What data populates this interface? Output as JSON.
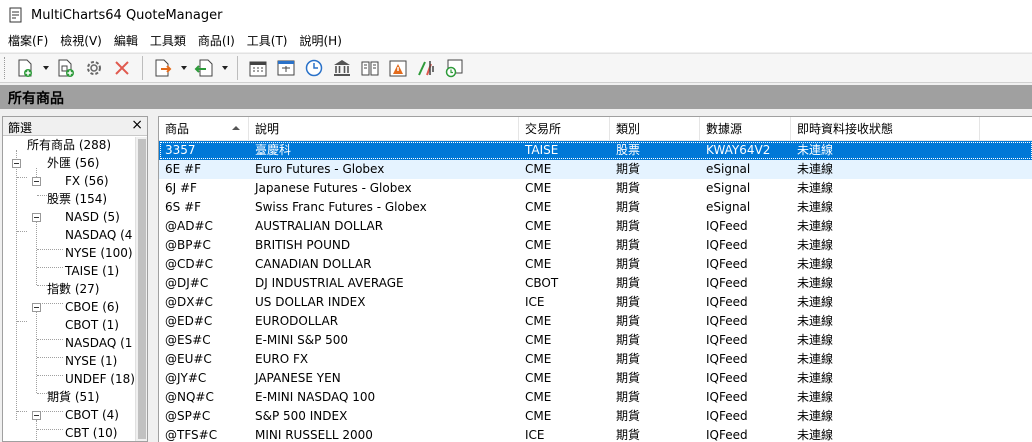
{
  "window": {
    "title": "MultiCharts64 QuoteManager"
  },
  "menu": [
    {
      "label": "檔案(F)"
    },
    {
      "label": "檢視(V)"
    },
    {
      "label": "編輯"
    },
    {
      "label": "工具類"
    },
    {
      "label": "商品(I)"
    },
    {
      "label": "工具(T)"
    },
    {
      "label": "說明(H)"
    }
  ],
  "toolbar_icons": [
    "new-symbol-icon",
    "add-symbol-icon",
    "settings-icon",
    "delete-icon",
    "import-icon",
    "export-icon",
    "calendar-icon",
    "session-icon",
    "clock-icon",
    "exchange-icon",
    "book-icon",
    "alert-icon",
    "chart-tools-icon",
    "schedule-icon"
  ],
  "section": {
    "title": "所有商品"
  },
  "filter": {
    "title": "篩選",
    "close": "×",
    "tree": [
      {
        "label": "所有商品 (288)",
        "level": 0,
        "expandable": true
      },
      {
        "label": "外匯 (56)",
        "level": 1,
        "expandable": true
      },
      {
        "label": "FX (56)",
        "level": 2,
        "expandable": false
      },
      {
        "label": "股票 (154)",
        "level": 1,
        "expandable": true
      },
      {
        "label": "NASD (5)",
        "level": 2,
        "expandable": false
      },
      {
        "label": "NASDAQ (4",
        "level": 2,
        "expandable": false
      },
      {
        "label": "NYSE (100)",
        "level": 2,
        "expandable": false
      },
      {
        "label": "TAISE (1)",
        "level": 2,
        "expandable": false
      },
      {
        "label": "指數 (27)",
        "level": 1,
        "expandable": true
      },
      {
        "label": "CBOE (6)",
        "level": 2,
        "expandable": false
      },
      {
        "label": "CBOT (1)",
        "level": 2,
        "expandable": false
      },
      {
        "label": "NASDAQ (1",
        "level": 2,
        "expandable": false
      },
      {
        "label": "NYSE (1)",
        "level": 2,
        "expandable": false
      },
      {
        "label": "UNDEF (18)",
        "level": 2,
        "expandable": false
      },
      {
        "label": "期貨 (51)",
        "level": 1,
        "expandable": true
      },
      {
        "label": "CBOT (4)",
        "level": 2,
        "expandable": false
      },
      {
        "label": "CBT (10)",
        "level": 2,
        "expandable": false
      }
    ]
  },
  "grid": {
    "columns": [
      "商品",
      "說明",
      "交易所",
      "類別",
      "數據源",
      "即時資料接收狀態"
    ],
    "rows": [
      [
        "3357",
        "臺慶科",
        "TAISE",
        "股票",
        "KWAY64V2",
        "未連線"
      ],
      [
        "6E #F",
        "Euro Futures - Globex",
        "CME",
        "期貨",
        "eSignal",
        "未連線"
      ],
      [
        "6J #F",
        "Japanese Futures - Globex",
        "CME",
        "期貨",
        "eSignal",
        "未連線"
      ],
      [
        "6S #F",
        "Swiss Franc Futures - Globex",
        "CME",
        "期貨",
        "eSignal",
        "未連線"
      ],
      [
        "@AD#C",
        "AUSTRALIAN DOLLAR",
        "CME",
        "期貨",
        "IQFeed",
        "未連線"
      ],
      [
        "@BP#C",
        "BRITISH POUND",
        "CME",
        "期貨",
        "IQFeed",
        "未連線"
      ],
      [
        "@CD#C",
        "CANADIAN DOLLAR",
        "CME",
        "期貨",
        "IQFeed",
        "未連線"
      ],
      [
        "@DJ#C",
        "DJ INDUSTRIAL AVERAGE",
        "CBOT",
        "期貨",
        "IQFeed",
        "未連線"
      ],
      [
        "@DX#C",
        "US DOLLAR INDEX",
        "ICE",
        "期貨",
        "IQFeed",
        "未連線"
      ],
      [
        "@ED#C",
        "EURODOLLAR",
        "CME",
        "期貨",
        "IQFeed",
        "未連線"
      ],
      [
        "@ES#C",
        "E-MINI S&P 500",
        "CME",
        "期貨",
        "IQFeed",
        "未連線"
      ],
      [
        "@EU#C",
        "EURO FX",
        "CME",
        "期貨",
        "IQFeed",
        "未連線"
      ],
      [
        "@JY#C",
        "JAPANESE YEN",
        "CME",
        "期貨",
        "IQFeed",
        "未連線"
      ],
      [
        "@NQ#C",
        "E-MINI NASDAQ 100",
        "CME",
        "期貨",
        "IQFeed",
        "未連線"
      ],
      [
        "@SP#C",
        "S&P 500 INDEX",
        "CME",
        "期貨",
        "IQFeed",
        "未連線"
      ],
      [
        "@TFS#C",
        "MINI RUSSELL 2000",
        "ICE",
        "期貨",
        "IQFeed",
        "未連線"
      ]
    ],
    "selected_row": 0,
    "hover_row": 1
  },
  "colors": {
    "selection": "#0078d7",
    "section_header": "#a0a0a0",
    "delete_icon": "#e05a4f",
    "accent_green": "#2e9b3a",
    "accent_orange": "#e36b1c"
  }
}
